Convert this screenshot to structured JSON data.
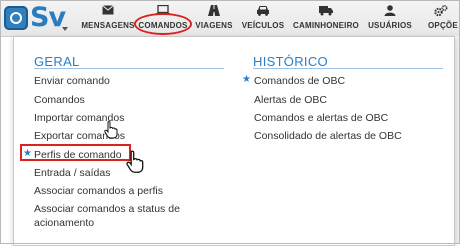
{
  "app": {
    "logo_text": "Sv"
  },
  "nav": {
    "items": [
      {
        "label": "MENSAGENS",
        "icon": "envelope-icon"
      },
      {
        "label": "COMANDOS",
        "icon": "laptop-icon"
      },
      {
        "label": "VIAGENS",
        "icon": "road-icon"
      },
      {
        "label": "VEÍCULOS",
        "icon": "car-icon"
      },
      {
        "label": "CAMINHONEIRO",
        "icon": "truck-icon"
      },
      {
        "label": "USUÁRIOS",
        "icon": "user-icon"
      },
      {
        "label": "OPÇÕE",
        "icon": "cogs-icon"
      }
    ]
  },
  "dropdown": {
    "geral": {
      "title": "GERAL",
      "items": [
        "Enviar comando",
        "Comandos",
        "Importar comandos",
        "Exportar comandos",
        "Perfis de comando",
        "Entrada / saídas",
        "Associar comandos a perfis",
        "Associar comandos a status de",
        "acionamento"
      ]
    },
    "historico": {
      "title": "HISTÓRICO",
      "items": [
        "Comandos de OBC",
        "Alertas de OBC",
        "Comandos e alertas de OBC",
        "Consolidado de alertas de OBC"
      ]
    }
  },
  "colors": {
    "accent": "#2d7fc3",
    "highlight": "#d9231f"
  }
}
